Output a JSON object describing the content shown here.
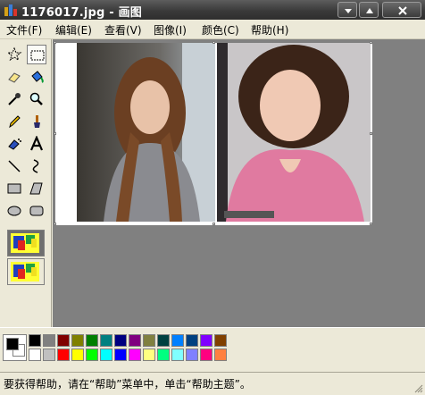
{
  "window": {
    "title": "1176017.jpg - 画图"
  },
  "menu": [
    "文件(F)",
    "编辑(E)",
    "查看(V)",
    "图像(I)",
    "颜色(C)",
    "帮助(H)"
  ],
  "tools": [
    "free-form-select",
    "rectangle-select",
    "eraser",
    "fill-with-color",
    "pick-color",
    "magnifier",
    "pencil",
    "brush",
    "airbrush",
    "text",
    "line",
    "curve",
    "rectangle",
    "polygon",
    "ellipse",
    "rounded-rectangle"
  ],
  "selected_tool": "rectangle-select",
  "colors": {
    "foreground": "#000000",
    "background": "#ffffff",
    "palette_top": [
      "#000000",
      "#808080",
      "#800000",
      "#808000",
      "#008000",
      "#008080",
      "#000080",
      "#800080",
      "#808040",
      "#004040",
      "#0080ff",
      "#004080",
      "#8000ff",
      "#804000"
    ],
    "palette_bottom": [
      "#ffffff",
      "#c0c0c0",
      "#ff0000",
      "#ffff00",
      "#00ff00",
      "#00ffff",
      "#0000ff",
      "#ff00ff",
      "#ffff80",
      "#00ff80",
      "#80ffff",
      "#8080ff",
      "#ff0080",
      "#ff8040"
    ]
  },
  "status": {
    "text": "要获得帮助，请在“帮助”菜单中，单击“帮助主题”。"
  }
}
